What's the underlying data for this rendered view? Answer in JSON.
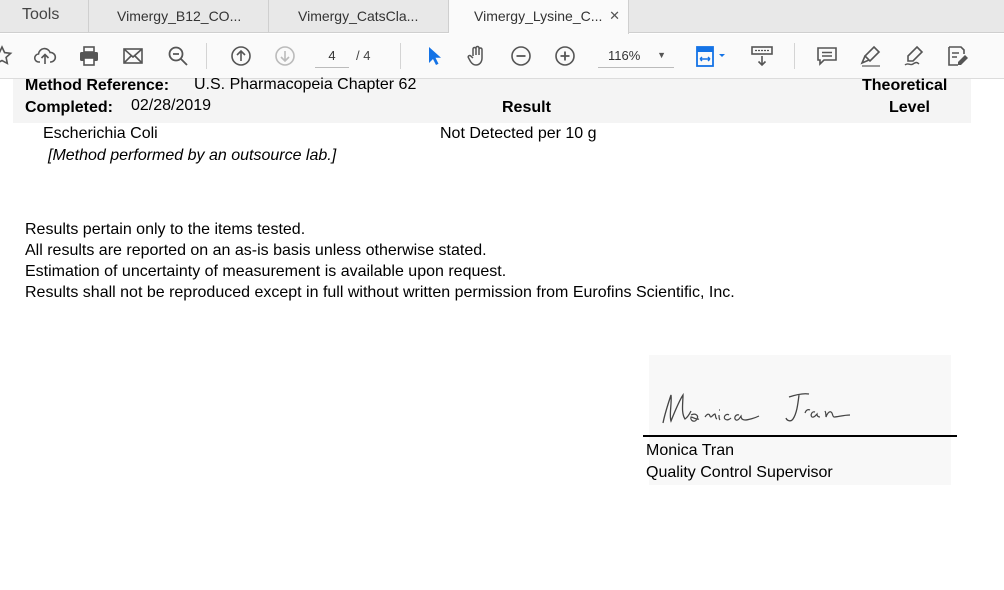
{
  "tabs": {
    "tools": "Tools",
    "items": [
      {
        "label": "Vimergy_B12_CO..."
      },
      {
        "label": "Vimergy_CatsCla..."
      },
      {
        "label": "Vimergy_Lysine_C..."
      }
    ],
    "close_glyph": "✕"
  },
  "toolbar": {
    "icons": [
      "star-icon",
      "upload-icon",
      "print-icon",
      "mail-icon",
      "search-icon",
      "prev-page-icon",
      "next-page-icon",
      "select-cursor-icon",
      "hand-icon",
      "zoom-out-icon",
      "zoom-in-icon",
      "fit-page-icon",
      "scroll-mode-icon",
      "comment-icon",
      "highlight-icon",
      "sign-icon",
      "fill-sign-icon"
    ],
    "page_current": "4",
    "page_total": "/ 4",
    "zoom": "116%",
    "accent_color": "#1473e6"
  },
  "document": {
    "method_reference_label": "Method Reference:",
    "method_reference_value": "U.S. Pharmacopeia Chapter 62",
    "theoretical_label": "Theoretical",
    "level_label": "Level",
    "completed_label": "Completed:",
    "completed_value": "02/28/2019",
    "result_header": "Result",
    "analyte": "Escherichia Coli",
    "result_value": "Not Detected per 10  g",
    "method_note": "[Method performed by an outsource lab.]",
    "disclaimers": [
      "Results pertain only to the items tested.",
      "All results are reported on an as-is basis unless otherwise stated.",
      "Estimation of uncertainty of measurement is available upon request.",
      "Results shall not be reproduced except in full without written permission from Eurofins Scientific, Inc."
    ],
    "signature_text": "Monica Tran",
    "signer_name": "Monica Tran",
    "signer_title": "Quality Control Supervisor"
  }
}
